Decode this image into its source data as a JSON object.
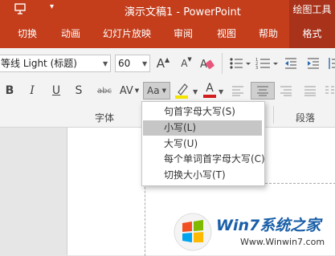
{
  "titlebar": {
    "doc_title": "演示文稿1 - PowerPoint",
    "context_tab": "绘图工具",
    "quick_access_dropdown": "▾"
  },
  "tabs": [
    {
      "label": "切换"
    },
    {
      "label": "动画"
    },
    {
      "label": "幻灯片放映"
    },
    {
      "label": "审阅"
    },
    {
      "label": "视图"
    },
    {
      "label": "帮助"
    },
    {
      "label": "格式",
      "active": true
    }
  ],
  "font": {
    "name": "等线 Light (标题)",
    "size": "60"
  },
  "buttons": {
    "grow": "A",
    "shrink": "A",
    "bold": "B",
    "italic": "I",
    "underline": "U",
    "strikethrough": "abc",
    "spacing": "AV",
    "change_case": "Aa",
    "font_color": "A",
    "highlight": "ab"
  },
  "groups": {
    "font": "字体",
    "paragraph": "段落"
  },
  "change_case_menu": {
    "items": [
      {
        "label": "句首字母大写(S)"
      },
      {
        "label": "小写(L)",
        "highlighted": true
      },
      {
        "label": "大写(U)"
      },
      {
        "label": "每个单词首字母大写(C)"
      },
      {
        "label": "切换大小写(T)"
      }
    ]
  },
  "watermark": {
    "brand": "Win7系统之家",
    "url": "Www.Winwin7.com"
  },
  "colors": {
    "accent": "#c43e1c",
    "accent_dark": "#a8321a",
    "highlight_yellow": "#f5e400",
    "font_red": "#d21d1d"
  }
}
